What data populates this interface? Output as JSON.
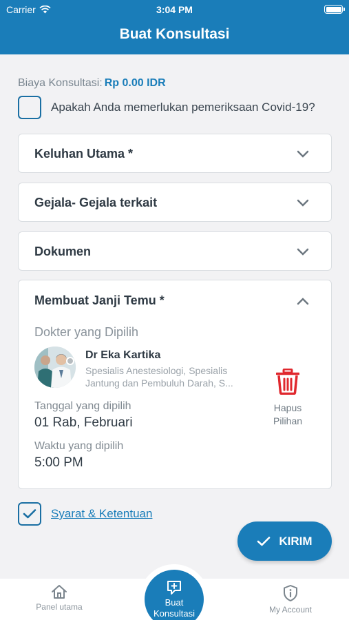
{
  "status_bar": {
    "carrier": "Carrier",
    "time": "3:04 PM"
  },
  "header": {
    "title": "Buat Konsultasi"
  },
  "fee": {
    "label": "Biaya Konsultasi:",
    "value": "Rp 0.00 IDR"
  },
  "covid": {
    "question": "Apakah Anda memerlukan pemeriksaan Covid-19?",
    "checked": false
  },
  "sections": [
    {
      "title": "Keluhan Utama *",
      "expanded": false
    },
    {
      "title": "Gejala- Gejala terkait",
      "expanded": false
    },
    {
      "title": "Dokumen",
      "expanded": false
    },
    {
      "title": "Membuat Janji Temu *",
      "expanded": true
    }
  ],
  "appointment": {
    "doctor_heading": "Dokter yang Dipilih",
    "doctor_name": "Dr Eka Kartika",
    "doctor_specialty_line1": "Spesialis Anestesiologi, Spesialis",
    "doctor_specialty_line2": "Jantung dan Pembuluh Darah, S...",
    "date_label": "Tanggal yang dipilih",
    "date_value": "01 Rab, Februari",
    "time_label": "Waktu yang dipilih",
    "time_value": "5:00 PM",
    "delete_line1": "Hapus",
    "delete_line2": "Pilihan"
  },
  "terms": {
    "label": "Syarat & Ketentuan",
    "checked": true
  },
  "submit": {
    "label": "KIRIM"
  },
  "tabbar": {
    "left": {
      "label": "Panel utama",
      "icon": "home-icon"
    },
    "center": {
      "line1": "Buat",
      "line2": "Konsultasi",
      "icon": "chat-plus-icon"
    },
    "right": {
      "label": "My Account",
      "icon": "shield-info-icon"
    }
  },
  "colors": {
    "primary": "#1a7db9",
    "delete": "#e0282e",
    "background": "#f2f2f4"
  }
}
